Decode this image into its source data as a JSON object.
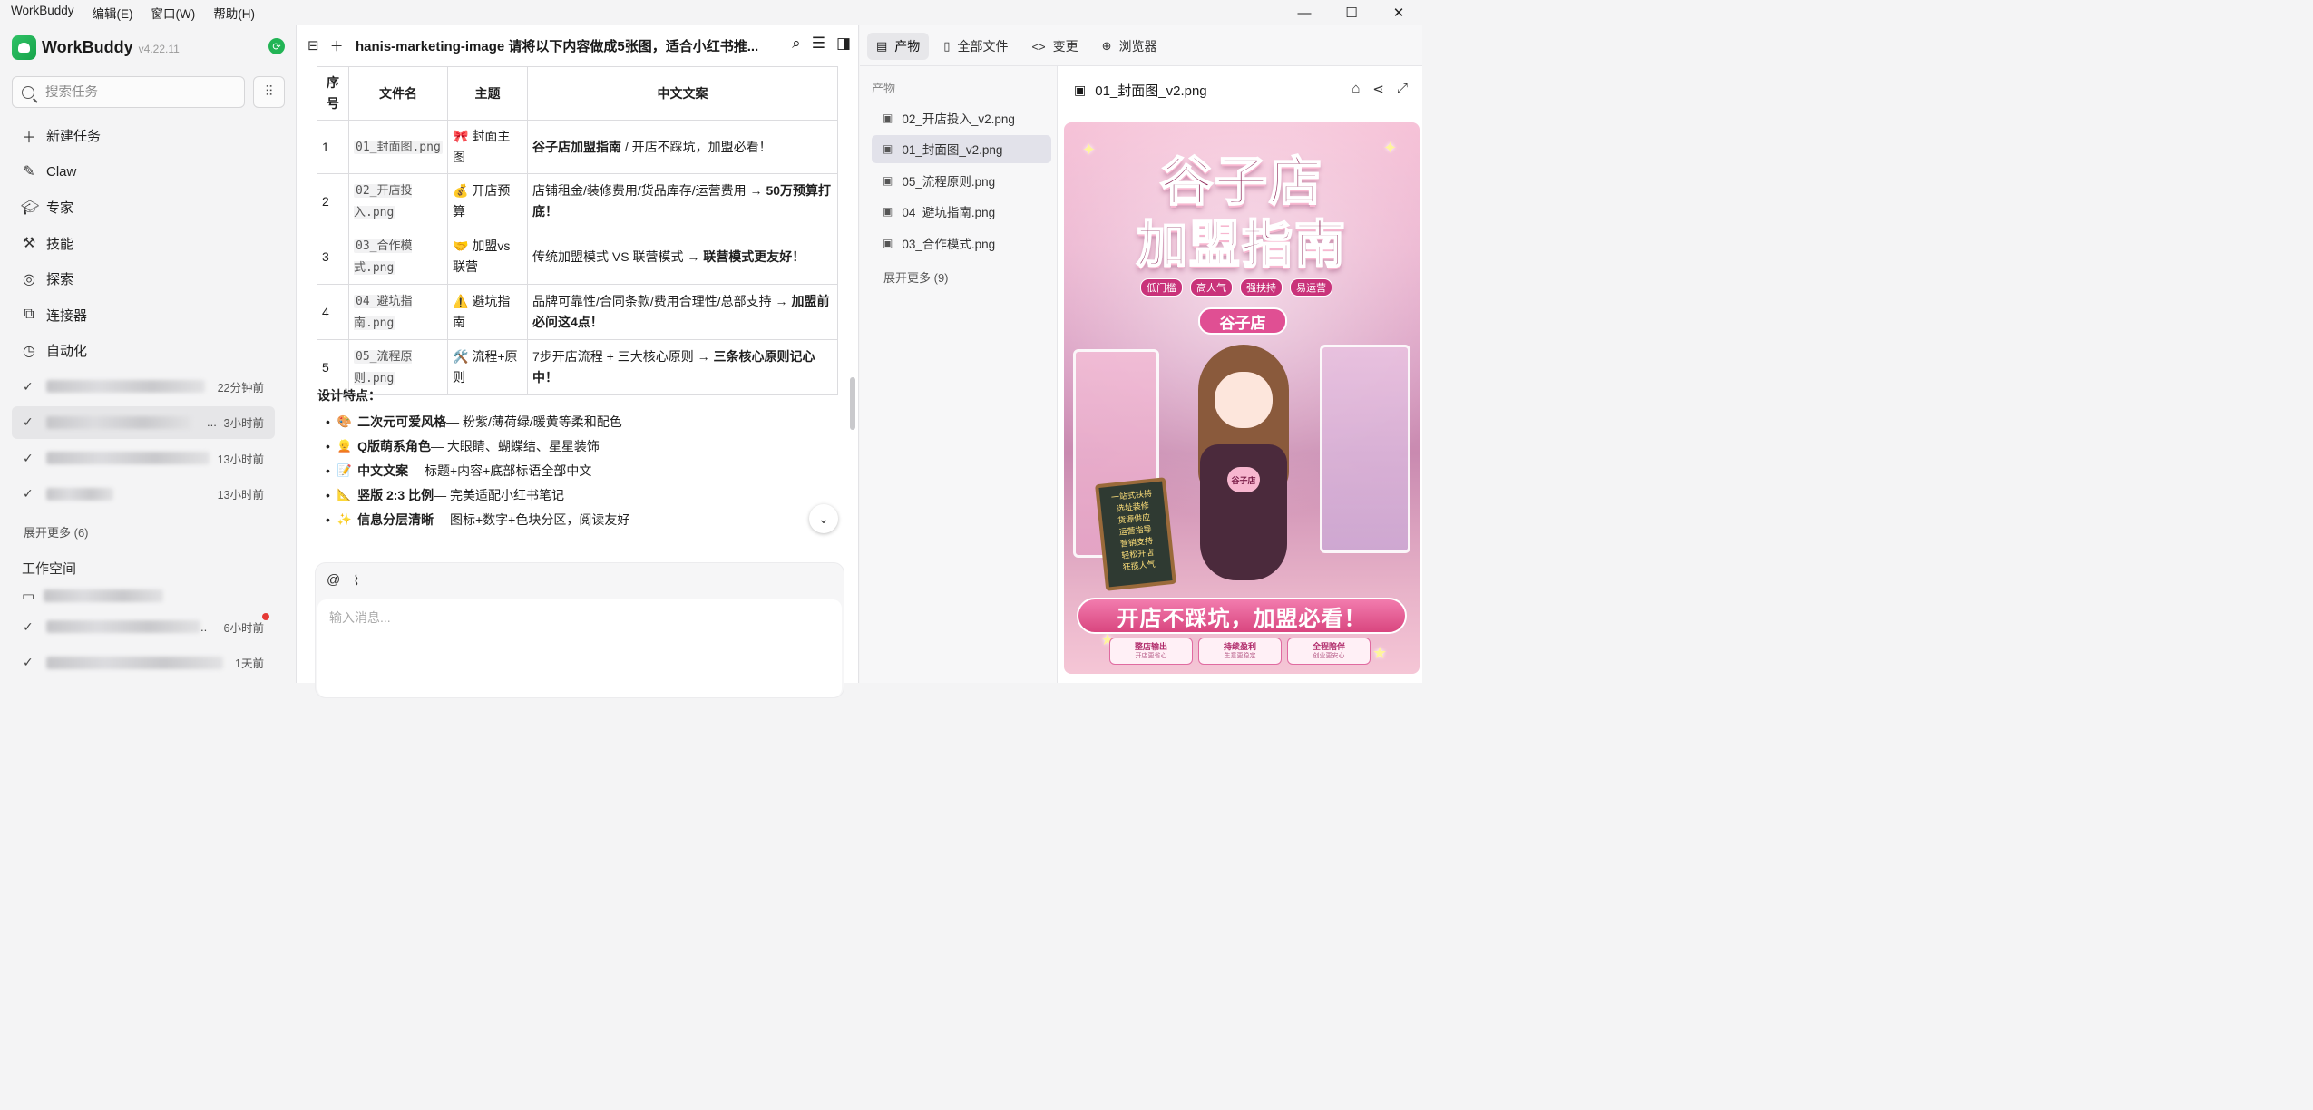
{
  "menu": {
    "app": "WorkBuddy",
    "edit": "编辑(E)",
    "window": "窗口(W)",
    "help": "帮助(H)"
  },
  "window_controls": {
    "minimize": "—",
    "maximize": "☐",
    "close": "✕"
  },
  "sidebar": {
    "brand": "WorkBuddy",
    "version": "v4.22.11",
    "search_placeholder": "搜索任务",
    "nav": [
      {
        "label": "新建任务",
        "icon": "plus-icon"
      },
      {
        "label": "Claw",
        "icon": "claw-icon"
      },
      {
        "label": "专家",
        "icon": "expert-icon"
      },
      {
        "label": "技能",
        "icon": "skill-icon"
      },
      {
        "label": "探索",
        "icon": "compass-icon"
      },
      {
        "label": "连接器",
        "icon": "connector-icon"
      },
      {
        "label": "自动化",
        "icon": "clock-icon"
      }
    ],
    "tasks": [
      {
        "time": "22分钟前"
      },
      {
        "time": "3小时前",
        "ellipsis": "..."
      },
      {
        "time": "13小时前"
      },
      {
        "time": "13小时前"
      }
    ],
    "tasks_more": "展开更多 (6)",
    "workspace_title": "工作空间",
    "workspace_tasks": [
      {
        "time": "6小时前",
        "ellipsis": ".."
      },
      {
        "time": "1天前"
      }
    ]
  },
  "chat": {
    "title": "hanis-marketing-image 请将以下内容做成5张图，适合小红书推...",
    "table": {
      "headers": [
        "序号",
        "文件名",
        "主题",
        "中文文案"
      ],
      "rows": [
        {
          "no": "1",
          "file": "01_封面图.png",
          "emoji": "🎀",
          "theme": "封面主图",
          "copy_bold": "谷子店加盟指南",
          "copy": " / 开店不踩坑，加盟必看！",
          "copy_tail": ""
        },
        {
          "no": "2",
          "file": "02_开店投入.png",
          "emoji": "💰",
          "theme": "开店预算",
          "copy_bold": "",
          "copy": "店铺租金/装修费用/货品库存/运营费用 → ",
          "copy_tail": "50万预算打底！"
        },
        {
          "no": "3",
          "file": "03_合作模式.png",
          "emoji": "🤝",
          "theme": "加盟vs联营",
          "copy_bold": "",
          "copy": "传统加盟模式 VS 联营模式 → ",
          "copy_tail": "联营模式更友好！"
        },
        {
          "no": "4",
          "file": "04_避坑指南.png",
          "emoji": "⚠️",
          "theme": "避坑指南",
          "copy_bold": "",
          "copy": "品牌可靠性/合同条款/费用合理性/总部支持 → ",
          "copy_tail": "加盟前必问这4点！"
        },
        {
          "no": "5",
          "file": "05_流程原则.png",
          "emoji": "🛠️",
          "theme": "流程+原则",
          "copy_bold": "",
          "copy": "7步开店流程 + 三大核心原则 → ",
          "copy_tail": "三条核心原则记心中！"
        }
      ]
    },
    "design_title": "设计特点：",
    "design_points": [
      {
        "emoji": "🎨",
        "bold": "二次元可爱风格",
        "text": " — 粉紫/薄荷绿/暖黄等柔和配色"
      },
      {
        "emoji": "👱",
        "bold": "Q版萌系角色",
        "text": " — 大眼睛、蝴蝶结、星星装饰"
      },
      {
        "emoji": "📝",
        "bold": "中文文案",
        "text": " — 标题+内容+底部标语全部中文"
      },
      {
        "emoji": "📐",
        "bold": "竖版 2:3 比例",
        "text": " — 完美适配小红书笔记"
      },
      {
        "emoji": "✨",
        "bold": "信息分层清晰",
        "text": " — 图标+数字+色块分区，阅读友好"
      }
    ],
    "input_placeholder": "输入消息..."
  },
  "right": {
    "tabs": [
      {
        "label": "产物",
        "icon": "doc-icon"
      },
      {
        "label": "全部文件",
        "icon": "file-icon"
      },
      {
        "label": "变更",
        "icon": "code-icon"
      },
      {
        "label": "浏览器",
        "icon": "globe-icon"
      }
    ],
    "files_label": "产物",
    "files": [
      "02_开店投入_v2.png",
      "01_封面图_v2.png",
      "05_流程原则.png",
      "04_避坑指南.png",
      "03_合作模式.png"
    ],
    "files_more": "展开更多 (9)",
    "preview_title": "01_封面图_v2.png",
    "poster": {
      "title1": "谷子店",
      "title2": "加盟指南",
      "tags": [
        "低门槛",
        "高人气",
        "强扶持",
        "易运营"
      ],
      "sign": "谷子店",
      "heart": "谷子店",
      "board": [
        "一站式扶持",
        "选址装修",
        "货源供应",
        "运营指导",
        "营销支持",
        "轻松开店",
        "狂揽人气"
      ],
      "banner": "开店不踩坑，加盟必看！",
      "badges": [
        {
          "a": "整店输出",
          "b": "开店更省心"
        },
        {
          "a": "持续盈利",
          "b": "生意更稳定"
        },
        {
          "a": "全程陪伴",
          "b": "创业更安心"
        }
      ]
    }
  },
  "colors": {
    "accent_green": "#22b455",
    "poster_pink": "#d9467f",
    "selected_bg": "#e6e6e8"
  }
}
